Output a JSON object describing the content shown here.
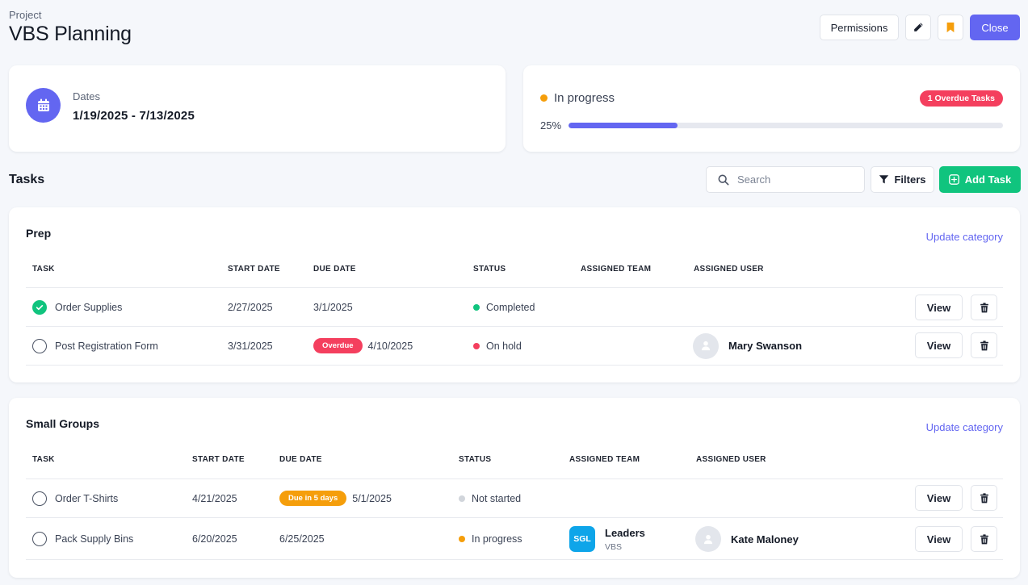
{
  "header": {
    "kicker": "Project",
    "title": "VBS Planning",
    "permissions_label": "Permissions",
    "edit_icon": "pencil-icon",
    "bookmark_icon": "bookmark-icon",
    "close_label": "Close"
  },
  "dates": {
    "label": "Dates",
    "value": "1/19/2025 - 7/13/2025",
    "icon": "calendar-icon"
  },
  "progress": {
    "status": "In progress",
    "status_color": "#f59e0b",
    "percent_label": "25%",
    "percent": 25,
    "overdue_badge": "1 Overdue Tasks"
  },
  "tasks": {
    "heading": "Tasks",
    "search_placeholder": "Search",
    "filters_label": "Filters",
    "add_label": "Add Task"
  },
  "columns": {
    "task": "TASK",
    "start": "START DATE",
    "due": "DUE DATE",
    "status": "STATUS",
    "team": "ASSIGNED TEAM",
    "user": "ASSIGNED USER",
    "view": "View"
  },
  "categories": [
    {
      "name": "Prep",
      "update_label": "Update category",
      "rows": [
        {
          "task": "Order Supplies",
          "done": true,
          "start": "2/27/2025",
          "due": "3/1/2025",
          "due_badge": "",
          "status": "Completed",
          "status_color": "#10c47e",
          "team": "",
          "team_sub": "",
          "user": ""
        },
        {
          "task": "Post Registration Form",
          "done": false,
          "start": "3/31/2025",
          "due": "4/10/2025",
          "due_badge": "Overdue",
          "status": "On hold",
          "status_color": "#f43f5e",
          "team": "",
          "team_sub": "",
          "user": "Mary Swanson"
        }
      ]
    },
    {
      "name": "Small Groups",
      "update_label": "Update category",
      "rows": [
        {
          "task": "Order T-Shirts",
          "done": false,
          "start": "4/21/2025",
          "due": "5/1/2025",
          "due_badge": "Due in 5 days",
          "status": "Not started",
          "status_color": "#d1d5db",
          "team": "",
          "team_sub": "",
          "user": ""
        },
        {
          "task": "Pack Supply Bins",
          "done": false,
          "start": "6/20/2025",
          "due": "6/25/2025",
          "due_badge": "",
          "status": "In progress",
          "status_color": "#f59e0b",
          "team": "Leaders",
          "team_badge": "SGL",
          "team_sub": "VBS",
          "user": "Kate Maloney"
        }
      ]
    }
  ]
}
